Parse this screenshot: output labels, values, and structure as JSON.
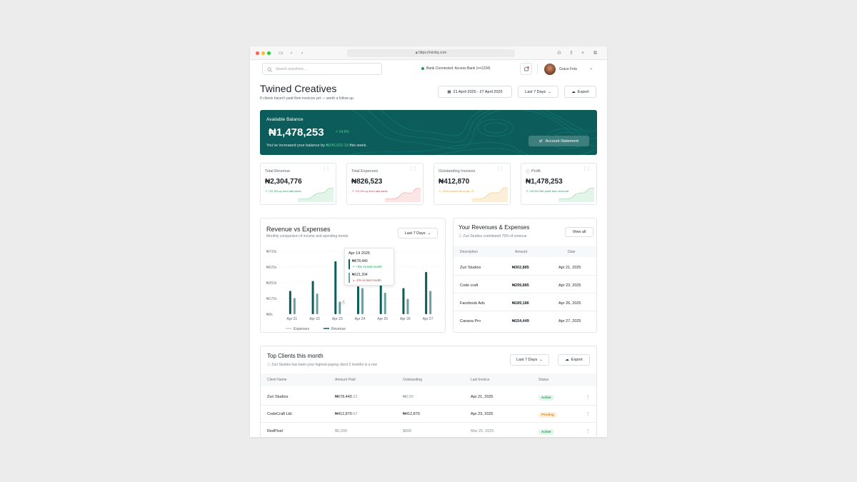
{
  "browser": {
    "url": "https://mintiq.com"
  },
  "header": {
    "search_placeholder": "Search anywhere...",
    "bank_status": "Bank Connected: Access Bank (•••1234)",
    "user_name": "Grace Fela"
  },
  "page": {
    "title": "Twined Creatives",
    "subtitle": "8 clients haven't paid their invoices yet — worth a follow-up.",
    "date_range": "21 April  2025 - 27 April 2025",
    "period": "Last 7 Days",
    "export": "Export"
  },
  "balance": {
    "label": "Available Balance",
    "amount": "₦1,478,253",
    "change": "14.9%",
    "note_prefix": "You've increased your balance by",
    "note_amount": "₦245,032.18",
    "note_suffix": "this week.",
    "statement_button": "Account Statement"
  },
  "stats": [
    {
      "label": "Total Revenue",
      "value": "₦2,304,776",
      "change": "+22.3% up from last week",
      "color": "#1e9c52"
    },
    {
      "label": "Total Expenses",
      "value": "₦826,523",
      "change": "+10.4% up from last week",
      "color": "#d2343a"
    },
    {
      "label": "Outstanding Invoices",
      "value": "₦412,870",
      "change": "-5.6% issued as of Apr 27",
      "color": "#e0a52c"
    },
    {
      "label": "Profit",
      "value": "₦1,478,253",
      "change": "+42.5% Net profit from revenue",
      "color": "#1e9c52"
    }
  ],
  "revenue_chart": {
    "title": "Revenue vs Expenses",
    "subtitle": "Monthly comparison of income and spending trends",
    "period": "Last 7 Days",
    "tooltip": {
      "date": "Apr 14 2025",
      "rev_value": "₦678,440",
      "rev_change": "+3% vs last month",
      "exp_value": "₦121,204",
      "exp_change": "-2% vs last month"
    }
  },
  "chart_data": {
    "type": "bar",
    "categories": [
      "Apr 21",
      "Apr 22",
      "Apr 23",
      "Apr 24",
      "Apr 25",
      "Apr 26",
      "Apr 27"
    ],
    "series": [
      {
        "name": "Revenue",
        "values": [
          260000,
          370000,
          590000,
          310000,
          380000,
          290000,
          470000
        ],
        "color": "#0b5c5a"
      },
      {
        "name": "Expenses",
        "values": [
          180000,
          230000,
          140000,
          290000,
          240000,
          170000,
          260000
        ],
        "color": "#6e9f9c"
      }
    ],
    "yticks": [
      "₦0k",
      "₦175k",
      "₦350k",
      "₦525k",
      "₦700k"
    ],
    "ylim": [
      0,
      700000
    ],
    "legend": [
      "Expenses",
      "Revenue"
    ],
    "legend_position": "bottom"
  },
  "transactions": {
    "title": "Your Revenues & Expenses",
    "subtitle": "Zuri Studios contributed 75% of revenue",
    "view_all": "View all",
    "headers": [
      "Description",
      "Amount",
      "Date"
    ],
    "rows": [
      {
        "desc": "Zuri Studios",
        "amount": "₦302,885",
        "date": "Apr 21, 2025",
        "color": "#1e9c52"
      },
      {
        "desc": "Code craft",
        "amount": "₦299,885",
        "date": "Apr 23, 2025",
        "color": "#1e9c52"
      },
      {
        "desc": "Facebook Ads",
        "amount": "₦189,186",
        "date": "Apr 26, 2025",
        "color": "#d2343a"
      },
      {
        "desc": "Canava Pro",
        "amount": "₦154,449",
        "date": "Apr 27, 2025",
        "color": "#d2343a"
      }
    ]
  },
  "clients": {
    "title": "Top Clients this month",
    "subtitle": "Zuri Studios has been your highest-paying client 3 months in a row",
    "period": "Last 7 Days",
    "export": "Export",
    "headers": [
      "Client Name",
      "Amount Paid",
      "Outstanding",
      "Last Invoice",
      "Status"
    ],
    "rows": [
      {
        "name": "Zuri Studios",
        "paid": "₦678,440",
        "paid_dec": ".22",
        "outstanding": "₦0.00",
        "invoice": "Apr 21, 2025",
        "status": "Active"
      },
      {
        "name": "CodeCraft Ltd.",
        "paid": "₦412,870",
        "paid_dec": ".67",
        "outstanding": "₦412,870",
        "invoice": "Apr 23, 2025",
        "status": "Pending"
      },
      {
        "name": "RedPixel",
        "paid": "$5,000",
        "paid_dec": "",
        "outstanding": "$800",
        "invoice": "Mar 25, 2025",
        "status": "Active"
      }
    ]
  }
}
